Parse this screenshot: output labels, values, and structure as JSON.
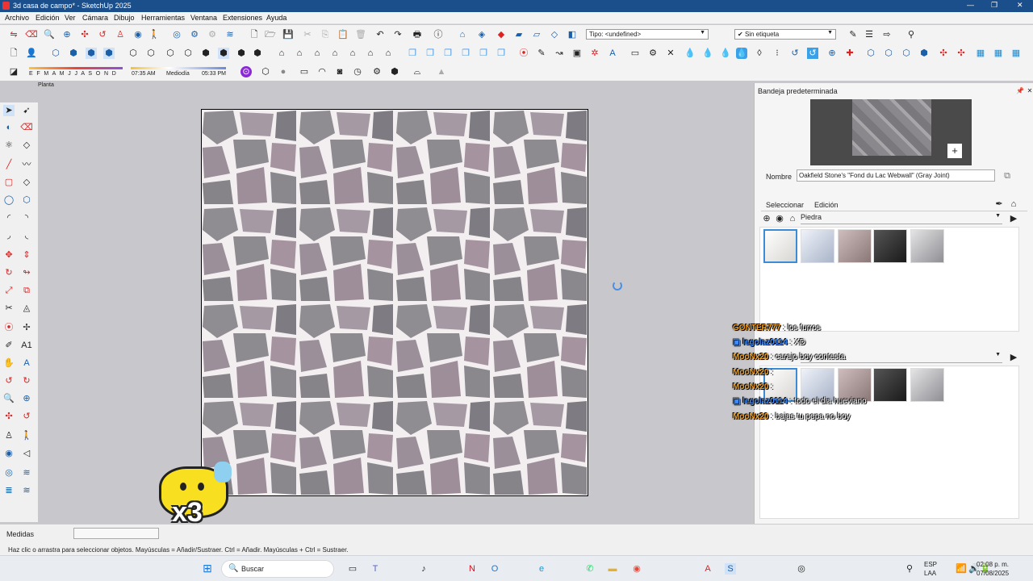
{
  "app": {
    "title": "3d casa de campo* - SketchUp 2025"
  },
  "menu": [
    "Archivo",
    "Edición",
    "Ver",
    "Cámara",
    "Dibujo",
    "Herramientas",
    "Ventana",
    "Extensiones",
    "Ayuda"
  ],
  "toolbar": {
    "tipo_label": "Tipo: <undefined>",
    "etiqueta_label": "Sin etiqueta"
  },
  "shadows": {
    "months": "E F M A M J J A S O N D",
    "time_start": "07:35 AM",
    "time_mid": "Mediodía",
    "time_end": "05:33 PM"
  },
  "scene": {
    "tab": "Planta"
  },
  "panel": {
    "title": "Bandeja predeterminada",
    "name_label": "Nombre",
    "material_name": "Oakfield Stone's \"Fond du Lac Webwall\" (Gray Joint)",
    "tab_select": "Seleccionar",
    "tab_edit": "Edición",
    "collection": "Piedra"
  },
  "chat": [
    {
      "user": "GONTER777",
      "sep": " : ",
      "text": "los furros",
      "color": "#f0a020"
    },
    {
      "user": "legolaz0114",
      "sep": " : ",
      "text": "XD",
      "color": "#3a8cff"
    },
    {
      "user": "MooNx20",
      "sep": " : ",
      "text": "carajo boy contesta",
      "color": "#f0a020"
    },
    {
      "user": "MooNx20",
      "sep": " : ",
      "text": "",
      "color": "#f0a020"
    },
    {
      "user": "MooNx20",
      "sep": " : ",
      "text": "",
      "color": "#f0a020"
    },
    {
      "user": "legolaz0114",
      "sep": " : ",
      "text": "todo el dia hueviano",
      "color": "#3a8cff"
    },
    {
      "user": "MooNx20",
      "sep": " : ",
      "text": "bajas tu pepa no boy",
      "color": "#f0a020"
    }
  ],
  "overlay": {
    "multiplier": "x3"
  },
  "status": {
    "measure_label": "Medidas",
    "hint": "Haz clic o arrastra para seleccionar objetos. Mayúsculas = Añadir/Sustraer. Ctrl = Añadir. Mayúsculas + Ctrl = Sustraer."
  },
  "taskbar": {
    "search": "Buscar",
    "lang1": "ESP",
    "lang2": "LAA",
    "time": "02:08 p. m.",
    "date": "07/08/2025"
  },
  "colors": {
    "titlebar": "#1a4f8b",
    "accent": "#2a7fd4"
  }
}
